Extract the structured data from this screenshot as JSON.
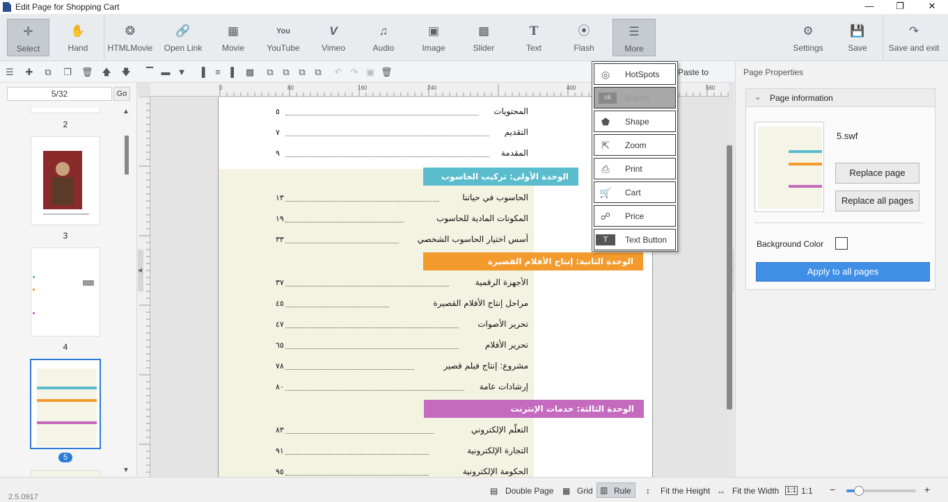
{
  "window": {
    "title": "Edit Page for Shopping Cart"
  },
  "toolbar": {
    "items": [
      {
        "label": "Select",
        "icon": "select-cursor-icon"
      },
      {
        "label": "Hand",
        "icon": "hand-icon"
      },
      {
        "label": "HTMLMovie",
        "icon": "film-reel-icon"
      },
      {
        "label": "Open Link",
        "icon": "link-icon"
      },
      {
        "label": "Movie",
        "icon": "film-icon"
      },
      {
        "label": "YouTube",
        "icon": "youtube-icon"
      },
      {
        "label": "Vimeo",
        "icon": "vimeo-icon"
      },
      {
        "label": "Audio",
        "icon": "music-note-icon"
      },
      {
        "label": "Image",
        "icon": "image-icon"
      },
      {
        "label": "Slider",
        "icon": "slider-icon"
      },
      {
        "label": "Text",
        "icon": "text-icon"
      },
      {
        "label": "Flash",
        "icon": "flash-icon"
      },
      {
        "label": "More",
        "icon": "more-icon"
      }
    ],
    "right": [
      {
        "label": "Settings",
        "icon": "gear-icon"
      },
      {
        "label": "Save",
        "icon": "save-icon"
      },
      {
        "label": "Save and exit",
        "icon": "save-exit-icon"
      }
    ]
  },
  "toolbar2": {
    "paste_label": "Paste to"
  },
  "pages": {
    "current": "5/32",
    "go": "Go",
    "thumbs": [
      "2",
      "3",
      "4",
      "5"
    ],
    "selected": "5"
  },
  "ruler": {
    "marks": [
      "0",
      "80",
      "160",
      "240",
      "400",
      "560"
    ]
  },
  "document": {
    "intro": [
      {
        "text": "المحتويات",
        "num": "٥"
      },
      {
        "text": "التقديم",
        "num": "٧"
      },
      {
        "text": "المقدمة",
        "num": "٩"
      }
    ],
    "units": [
      {
        "title": "الوحدة الأولى: تركيب الحاسوب",
        "color": "#5bbccd",
        "items": [
          {
            "text": "الحاسوب في حياتنا",
            "num": "١٣"
          },
          {
            "text": "المكونات المادية للحاسوب",
            "num": "١٩"
          },
          {
            "text": "أسس اختيار الحاسوب الشخصي",
            "num": "٣٣"
          }
        ]
      },
      {
        "title": "الوحدة الثانية: إنتاج الأفلام القصيرة",
        "color": "#f39a2c",
        "items": [
          {
            "text": "الأجهزة الرقمية",
            "num": "٣٧"
          },
          {
            "text": "مراحل إنتاج الأفلام القصيرة",
            "num": "٤٥"
          },
          {
            "text": "تحرير الأصوات",
            "num": "٤٧"
          },
          {
            "text": "تحرير الأفلام",
            "num": "٦٥"
          },
          {
            "text": "مشروع: إنتاج فيلم قصير",
            "num": "٧٨"
          },
          {
            "text": "إرشادات عامة",
            "num": "٨٠"
          }
        ]
      },
      {
        "title": "الوحدة الثالثة: خدمات الإنترنت",
        "color": "#c56bbf",
        "items": [
          {
            "text": "التعلّم الإلكتروني",
            "num": "٨٣"
          },
          {
            "text": "التجارة الإلكترونية",
            "num": "٩١"
          },
          {
            "text": "الحكومة الإلكترونية",
            "num": "٩٥"
          }
        ]
      }
    ]
  },
  "dropdown": {
    "items": [
      {
        "label": "HotSpots",
        "icon": "hotspot-icon"
      },
      {
        "label": "Button",
        "icon": "ok-button-icon",
        "disabled": true
      },
      {
        "label": "Shape",
        "icon": "shape-icon"
      },
      {
        "label": "Zoom",
        "icon": "zoom-icon"
      },
      {
        "label": "Print",
        "icon": "print-icon"
      },
      {
        "label": "Cart",
        "icon": "cart-icon"
      },
      {
        "label": "Price",
        "icon": "price-tag-icon"
      },
      {
        "label": "Text Button",
        "icon": "text-button-icon"
      }
    ]
  },
  "properties": {
    "panel_title": "Page Properties",
    "section": "Page information",
    "filename": "5.swf",
    "replace_page": "Replace page",
    "replace_all": "Replace all pages",
    "bg_label": "Background Color",
    "apply_all": "Apply to all pages"
  },
  "status": {
    "version": "2.5.0917",
    "double_page": "Double Page",
    "grid": "Grid",
    "rule": "Rule",
    "fit_height": "Fit the Height",
    "fit_width": "Fit the Width",
    "one_to_one": "1:1",
    "zoom_fraction": 0.18
  }
}
